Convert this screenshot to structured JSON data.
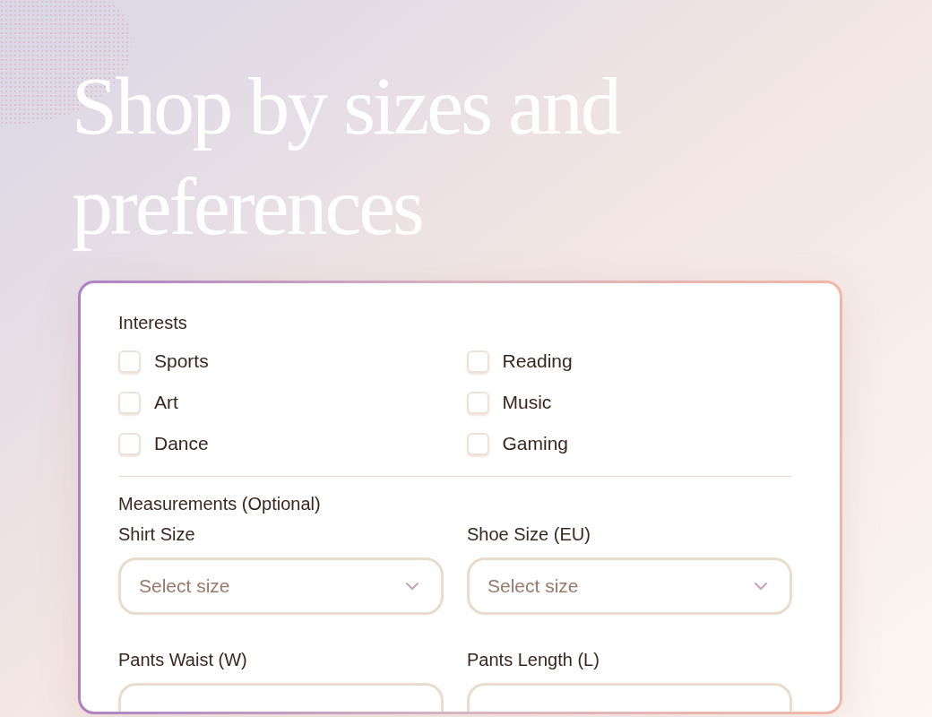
{
  "heading": "Shop by sizes and preferences",
  "interests": {
    "label": "Interests",
    "options": [
      {
        "label": "Sports",
        "checked": false
      },
      {
        "label": "Reading",
        "checked": false
      },
      {
        "label": "Art",
        "checked": false
      },
      {
        "label": "Music",
        "checked": false
      },
      {
        "label": "Dance",
        "checked": false
      },
      {
        "label": "Gaming",
        "checked": false
      }
    ]
  },
  "measurements": {
    "label": "Measurements (Optional)",
    "fields": [
      {
        "label": "Shirt Size",
        "placeholder": "Select size"
      },
      {
        "label": "Shoe Size (EU)",
        "placeholder": "Select size"
      },
      {
        "label": "Pants Waist (W)"
      },
      {
        "label": "Pants Length (L)"
      }
    ]
  }
}
